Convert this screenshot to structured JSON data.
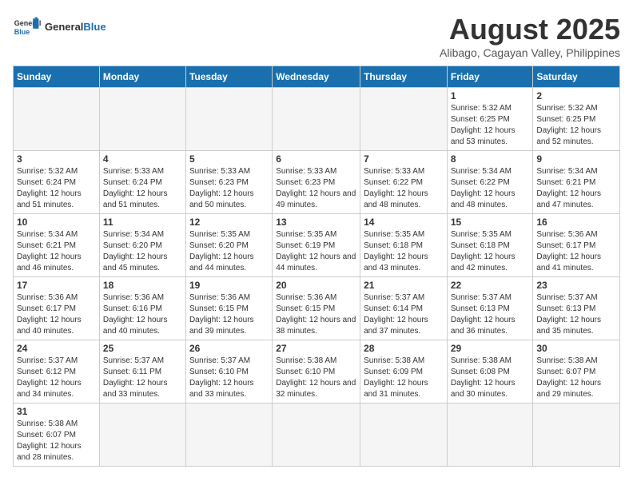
{
  "header": {
    "logo_general": "General",
    "logo_blue": "Blue",
    "month_year": "August 2025",
    "location": "Alibago, Cagayan Valley, Philippines"
  },
  "days_of_week": [
    "Sunday",
    "Monday",
    "Tuesday",
    "Wednesday",
    "Thursday",
    "Friday",
    "Saturday"
  ],
  "weeks": [
    [
      {
        "day": "",
        "info": ""
      },
      {
        "day": "",
        "info": ""
      },
      {
        "day": "",
        "info": ""
      },
      {
        "day": "",
        "info": ""
      },
      {
        "day": "",
        "info": ""
      },
      {
        "day": "1",
        "info": "Sunrise: 5:32 AM\nSunset: 6:25 PM\nDaylight: 12 hours\nand 53 minutes."
      },
      {
        "day": "2",
        "info": "Sunrise: 5:32 AM\nSunset: 6:25 PM\nDaylight: 12 hours\nand 52 minutes."
      }
    ],
    [
      {
        "day": "3",
        "info": "Sunrise: 5:32 AM\nSunset: 6:24 PM\nDaylight: 12 hours\nand 51 minutes."
      },
      {
        "day": "4",
        "info": "Sunrise: 5:33 AM\nSunset: 6:24 PM\nDaylight: 12 hours\nand 51 minutes."
      },
      {
        "day": "5",
        "info": "Sunrise: 5:33 AM\nSunset: 6:23 PM\nDaylight: 12 hours\nand 50 minutes."
      },
      {
        "day": "6",
        "info": "Sunrise: 5:33 AM\nSunset: 6:23 PM\nDaylight: 12 hours\nand 49 minutes."
      },
      {
        "day": "7",
        "info": "Sunrise: 5:33 AM\nSunset: 6:22 PM\nDaylight: 12 hours\nand 48 minutes."
      },
      {
        "day": "8",
        "info": "Sunrise: 5:34 AM\nSunset: 6:22 PM\nDaylight: 12 hours\nand 48 minutes."
      },
      {
        "day": "9",
        "info": "Sunrise: 5:34 AM\nSunset: 6:21 PM\nDaylight: 12 hours\nand 47 minutes."
      }
    ],
    [
      {
        "day": "10",
        "info": "Sunrise: 5:34 AM\nSunset: 6:21 PM\nDaylight: 12 hours\nand 46 minutes."
      },
      {
        "day": "11",
        "info": "Sunrise: 5:34 AM\nSunset: 6:20 PM\nDaylight: 12 hours\nand 45 minutes."
      },
      {
        "day": "12",
        "info": "Sunrise: 5:35 AM\nSunset: 6:20 PM\nDaylight: 12 hours\nand 44 minutes."
      },
      {
        "day": "13",
        "info": "Sunrise: 5:35 AM\nSunset: 6:19 PM\nDaylight: 12 hours\nand 44 minutes."
      },
      {
        "day": "14",
        "info": "Sunrise: 5:35 AM\nSunset: 6:18 PM\nDaylight: 12 hours\nand 43 minutes."
      },
      {
        "day": "15",
        "info": "Sunrise: 5:35 AM\nSunset: 6:18 PM\nDaylight: 12 hours\nand 42 minutes."
      },
      {
        "day": "16",
        "info": "Sunrise: 5:36 AM\nSunset: 6:17 PM\nDaylight: 12 hours\nand 41 minutes."
      }
    ],
    [
      {
        "day": "17",
        "info": "Sunrise: 5:36 AM\nSunset: 6:17 PM\nDaylight: 12 hours\nand 40 minutes."
      },
      {
        "day": "18",
        "info": "Sunrise: 5:36 AM\nSunset: 6:16 PM\nDaylight: 12 hours\nand 40 minutes."
      },
      {
        "day": "19",
        "info": "Sunrise: 5:36 AM\nSunset: 6:15 PM\nDaylight: 12 hours\nand 39 minutes."
      },
      {
        "day": "20",
        "info": "Sunrise: 5:36 AM\nSunset: 6:15 PM\nDaylight: 12 hours\nand 38 minutes."
      },
      {
        "day": "21",
        "info": "Sunrise: 5:37 AM\nSunset: 6:14 PM\nDaylight: 12 hours\nand 37 minutes."
      },
      {
        "day": "22",
        "info": "Sunrise: 5:37 AM\nSunset: 6:13 PM\nDaylight: 12 hours\nand 36 minutes."
      },
      {
        "day": "23",
        "info": "Sunrise: 5:37 AM\nSunset: 6:13 PM\nDaylight: 12 hours\nand 35 minutes."
      }
    ],
    [
      {
        "day": "24",
        "info": "Sunrise: 5:37 AM\nSunset: 6:12 PM\nDaylight: 12 hours\nand 34 minutes."
      },
      {
        "day": "25",
        "info": "Sunrise: 5:37 AM\nSunset: 6:11 PM\nDaylight: 12 hours\nand 33 minutes."
      },
      {
        "day": "26",
        "info": "Sunrise: 5:37 AM\nSunset: 6:10 PM\nDaylight: 12 hours\nand 33 minutes."
      },
      {
        "day": "27",
        "info": "Sunrise: 5:38 AM\nSunset: 6:10 PM\nDaylight: 12 hours\nand 32 minutes."
      },
      {
        "day": "28",
        "info": "Sunrise: 5:38 AM\nSunset: 6:09 PM\nDaylight: 12 hours\nand 31 minutes."
      },
      {
        "day": "29",
        "info": "Sunrise: 5:38 AM\nSunset: 6:08 PM\nDaylight: 12 hours\nand 30 minutes."
      },
      {
        "day": "30",
        "info": "Sunrise: 5:38 AM\nSunset: 6:07 PM\nDaylight: 12 hours\nand 29 minutes."
      }
    ],
    [
      {
        "day": "31",
        "info": "Sunrise: 5:38 AM\nSunset: 6:07 PM\nDaylight: 12 hours\nand 28 minutes."
      },
      {
        "day": "",
        "info": ""
      },
      {
        "day": "",
        "info": ""
      },
      {
        "day": "",
        "info": ""
      },
      {
        "day": "",
        "info": ""
      },
      {
        "day": "",
        "info": ""
      },
      {
        "day": "",
        "info": ""
      }
    ]
  ]
}
